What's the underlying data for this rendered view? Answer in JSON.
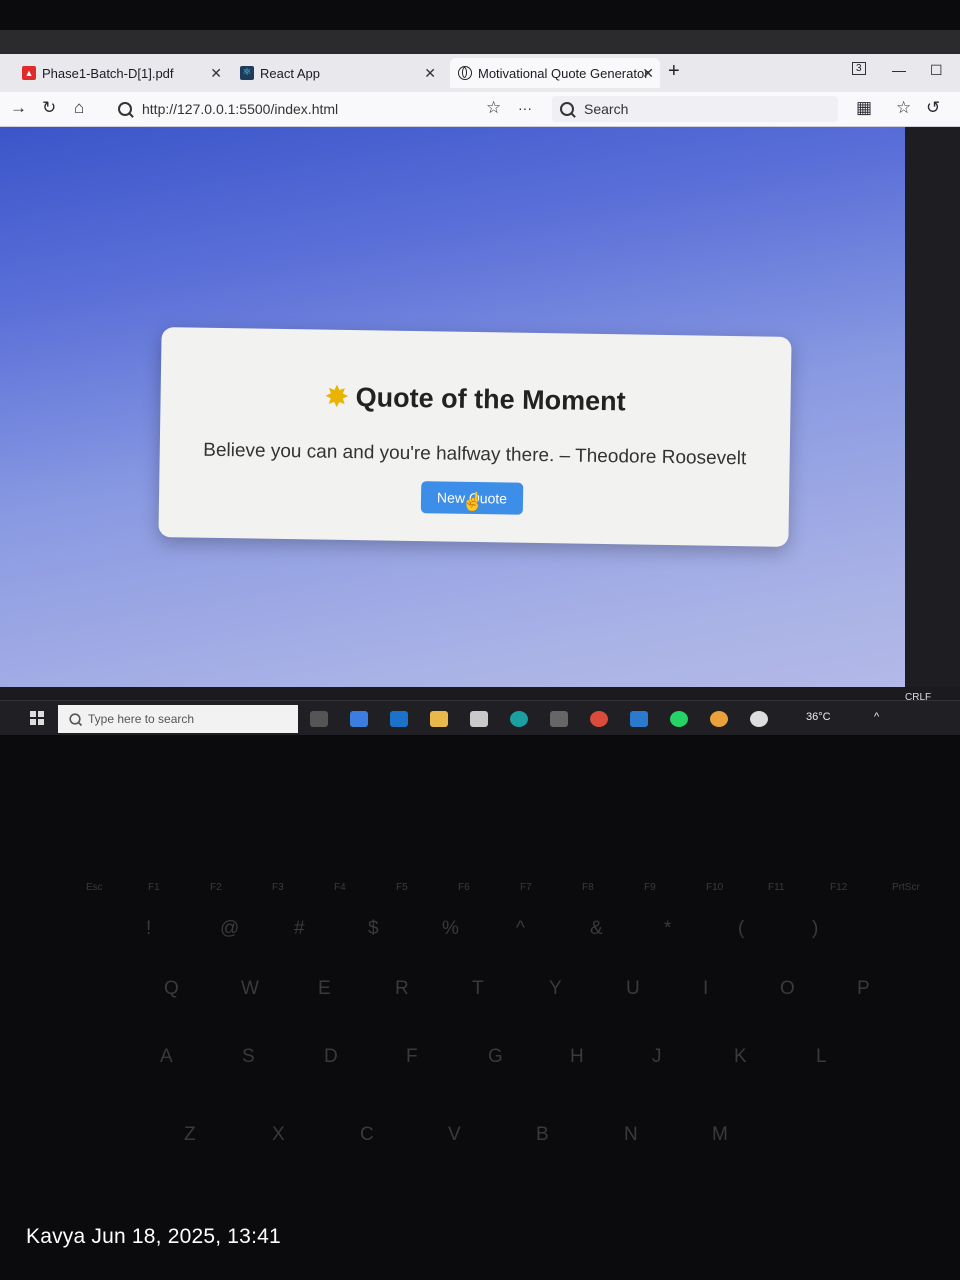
{
  "browser": {
    "tabs": [
      {
        "label": "Phase1-Batch-D[1].pdf",
        "icon": "pdf-icon"
      },
      {
        "label": "React App",
        "icon": "react-icon"
      },
      {
        "label": "Motivational Quote Generator",
        "icon": "globe-icon"
      }
    ],
    "url": "http://127.0.0.1:5500/index.html",
    "search_placeholder": "Search"
  },
  "page": {
    "title": "Quote of the Moment",
    "title_icon": "star-icon",
    "quote": "Believe you can and you're halfway there. – Theodore Roosevelt",
    "button_label": "New Quote",
    "accent": "#3d8ee8"
  },
  "statusbar": {
    "line_ending": "CRLF"
  },
  "taskbar": {
    "search_placeholder": "Type here to search",
    "temperature": "36°C"
  },
  "keyboard": {
    "fkeys": [
      "Esc",
      "F1",
      "F2",
      "F3",
      "F4",
      "F5",
      "F6",
      "F7",
      "F8",
      "F9",
      "F10",
      "F11",
      "F12",
      "PrtScr"
    ],
    "numbers": [
      "!",
      "@",
      "#",
      "$",
      "%",
      "^",
      "&",
      "*",
      "(",
      ")"
    ],
    "row1": [
      "Q",
      "W",
      "E",
      "R",
      "T",
      "Y",
      "U",
      "I",
      "O",
      "P"
    ],
    "row2": [
      "A",
      "S",
      "D",
      "F",
      "G",
      "H",
      "J",
      "K",
      "L"
    ],
    "row3": [
      "Z",
      "X",
      "C",
      "V",
      "B",
      "N",
      "M"
    ]
  },
  "caption": "Kavya  Jun 18, 2025, 13:41"
}
